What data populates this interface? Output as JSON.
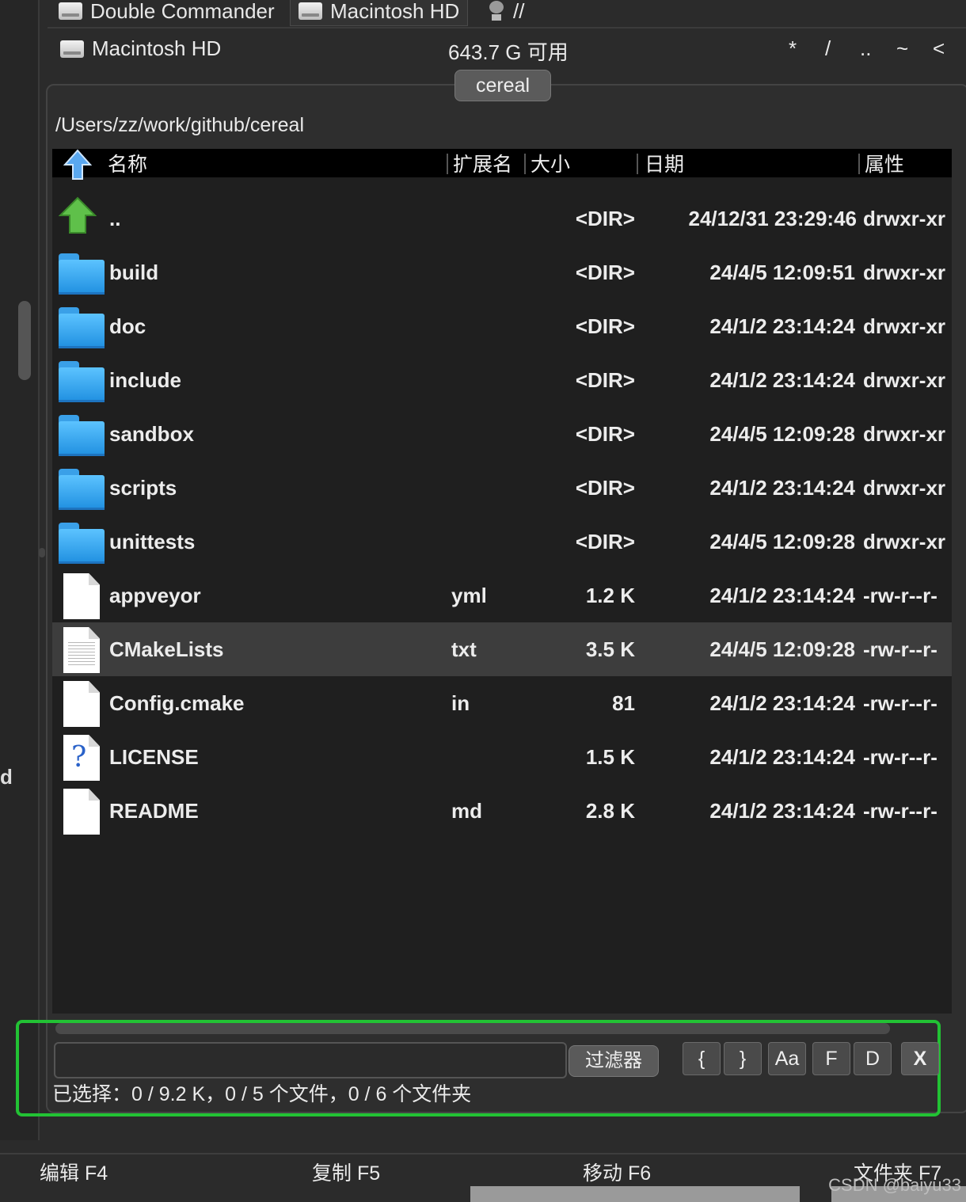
{
  "drive_tabs": [
    {
      "label": "Double Commander"
    },
    {
      "label": "Macintosh HD"
    },
    {
      "label": "//"
    }
  ],
  "disk": {
    "name": "Macintosh HD",
    "free": "643.7 G 可用",
    "nav": [
      "*",
      "/",
      "..",
      "~",
      "<"
    ]
  },
  "folder_tab": "cereal",
  "path": "/Users/zz/work/github/cereal",
  "columns": {
    "name": "名称",
    "ext": "扩展名",
    "size": "大小",
    "date": "日期",
    "attr": "属性"
  },
  "files": [
    {
      "name": "..",
      "ext": "",
      "size": "<DIR>",
      "date": "24/12/31 23:29:46",
      "attr": "drwxr-xr",
      "icon": "up-folder-icon"
    },
    {
      "name": "build",
      "ext": "",
      "size": "<DIR>",
      "date": "24/4/5 12:09:51",
      "attr": "drwxr-xr",
      "icon": "folder-icon"
    },
    {
      "name": "doc",
      "ext": "",
      "size": "<DIR>",
      "date": "24/1/2 23:14:24",
      "attr": "drwxr-xr",
      "icon": "folder-icon"
    },
    {
      "name": "include",
      "ext": "",
      "size": "<DIR>",
      "date": "24/1/2 23:14:24",
      "attr": "drwxr-xr",
      "icon": "folder-icon"
    },
    {
      "name": "sandbox",
      "ext": "",
      "size": "<DIR>",
      "date": "24/4/5 12:09:28",
      "attr": "drwxr-xr",
      "icon": "folder-icon"
    },
    {
      "name": "scripts",
      "ext": "",
      "size": "<DIR>",
      "date": "24/1/2 23:14:24",
      "attr": "drwxr-xr",
      "icon": "folder-icon"
    },
    {
      "name": "unittests",
      "ext": "",
      "size": "<DIR>",
      "date": "24/4/5 12:09:28",
      "attr": "drwxr-xr",
      "icon": "folder-icon"
    },
    {
      "name": "appveyor",
      "ext": "yml",
      "size": "1.2 K",
      "date": "24/1/2 23:14:24",
      "attr": "-rw-r--r-",
      "icon": "file-icon"
    },
    {
      "name": "CMakeLists",
      "ext": "txt",
      "size": "3.5 K",
      "date": "24/4/5 12:09:28",
      "attr": "-rw-r--r-",
      "icon": "text-file-icon",
      "selected": true
    },
    {
      "name": "Config.cmake",
      "ext": "in",
      "size": "81",
      "date": "24/1/2 23:14:24",
      "attr": "-rw-r--r-",
      "icon": "file-icon"
    },
    {
      "name": "LICENSE",
      "ext": "",
      "size": "1.5 K",
      "date": "24/1/2 23:14:24",
      "attr": "-rw-r--r-",
      "icon": "unknown-file-icon"
    },
    {
      "name": "README",
      "ext": "md",
      "size": "2.8 K",
      "date": "24/1/2 23:14:24",
      "attr": "-rw-r--r-",
      "icon": "file-icon"
    }
  ],
  "filter": {
    "input_value": "",
    "button": "过滤器",
    "toggles": [
      "{",
      "}",
      "Aa",
      "F",
      "D"
    ],
    "close": "X"
  },
  "status": "已选择：0 / 9.2 K，0 / 5 个文件，0 / 6 个文件夹",
  "function_keys": [
    "编辑 F4",
    "复制 F5",
    "移动 F6",
    "文件夹 F7"
  ],
  "left_fragment": "d",
  "watermark": "CSDN @baiyu33"
}
